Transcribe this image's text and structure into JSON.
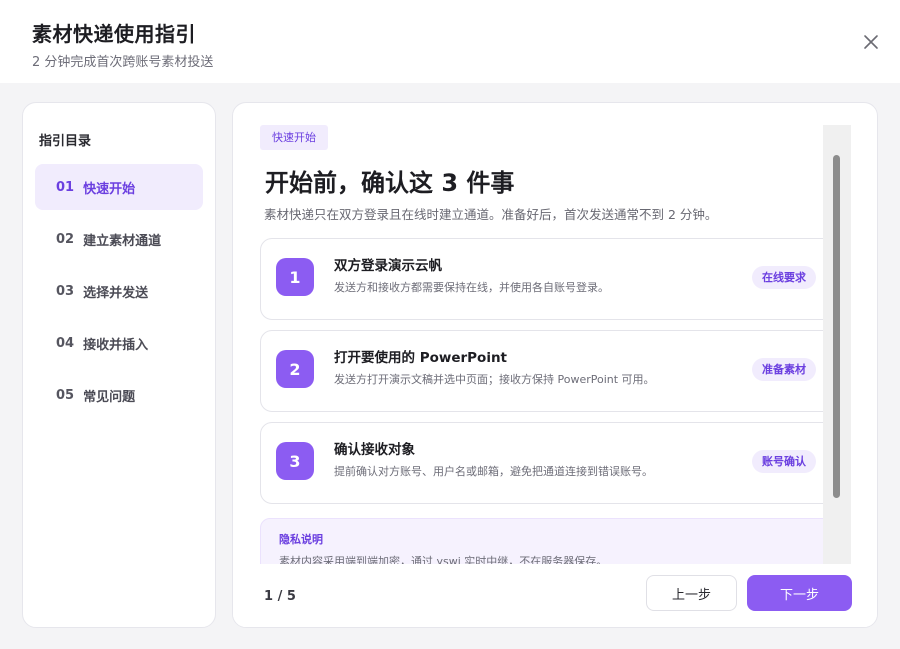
{
  "header": {
    "title": "素材快递使用指引",
    "subtitle": "2 分钟完成首次跨账号素材投送",
    "close_icon": "close-icon"
  },
  "sidebar": {
    "title": "指引目录",
    "items": [
      {
        "num": "01",
        "label": "快速开始",
        "active": true
      },
      {
        "num": "02",
        "label": "建立素材通道",
        "active": false
      },
      {
        "num": "03",
        "label": "选择并发送",
        "active": false
      },
      {
        "num": "04",
        "label": "接收并插入",
        "active": false
      },
      {
        "num": "05",
        "label": "常见问题",
        "active": false
      }
    ]
  },
  "main": {
    "tag": "快速开始",
    "heading": "开始前，确认这 3 件事",
    "description": "素材快递只在双方登录且在线时建立通道。准备好后，首次发送通常不到 2 分钟。",
    "steps": [
      {
        "num": "1",
        "title": "双方登录演示云帆",
        "desc": "发送方和接收方都需要保持在线，并使用各自账号登录。",
        "badge": "在线要求"
      },
      {
        "num": "2",
        "title": "打开要使用的 PowerPoint",
        "desc": "发送方打开演示文稿并选中页面；接收方保持 PowerPoint 可用。",
        "badge": "准备素材"
      },
      {
        "num": "3",
        "title": "确认接收对象",
        "desc": "提前确认对方账号、用户名或邮箱，避免把通道连接到错误账号。",
        "badge": "账号确认"
      }
    ],
    "privacy": {
      "title": "隐私说明",
      "text": "素材内容采用端到端加密，通过 yswi 实时中继，不在服务器保存。"
    }
  },
  "footer": {
    "page_indicator": "1 / 5",
    "prev_label": "上一步",
    "next_label": "下一步"
  },
  "colors": {
    "accent": "#8c5cf2",
    "accent_text": "#6b3fe0",
    "accent_soft": "#f1ecfd"
  }
}
